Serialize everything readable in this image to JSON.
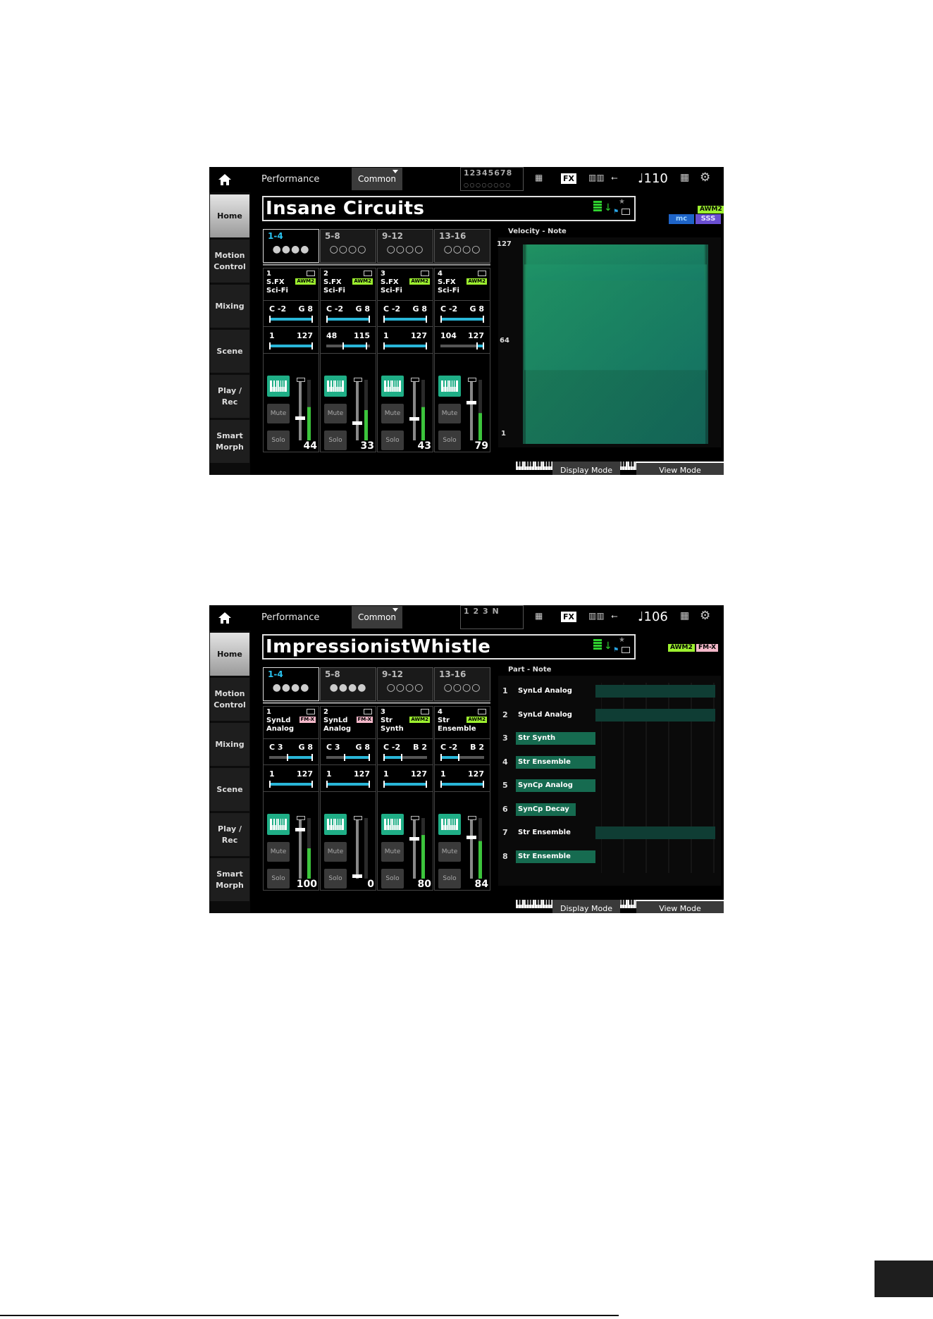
{
  "screens": [
    {
      "header": {
        "title": "Performance",
        "dropdown": "Common",
        "part_numbers": "12345678",
        "part_dots": "○○○○○○○○",
        "tempo": "♩110"
      },
      "sidebar": [
        "Home",
        "Motion Control",
        "Mixing",
        "Scene",
        "Play / Rec",
        "Smart Morph"
      ],
      "performance_name": "Insane Circuits",
      "engine_badges": [
        "AWM2"
      ],
      "group_tabs": [
        {
          "label": "1-4",
          "dots": "●●●●"
        },
        {
          "label": "5-8",
          "dots": "○○○○"
        },
        {
          "label": "9-12",
          "dots": "○○○○"
        },
        {
          "label": "13-16",
          "dots": "○○○○"
        }
      ],
      "parts": [
        {
          "num": "1",
          "cat": "S.FX",
          "sub": "Sci-Fi",
          "badge": "AWM2",
          "note_lo": "C -2",
          "note_hi": "G 8",
          "vel_lo": "1",
          "vel_hi": "127",
          "volume": "44",
          "note_range": [
            0,
            1
          ],
          "vel_range": [
            0,
            1
          ],
          "fader": 0.35,
          "meter": 0.55
        },
        {
          "num": "2",
          "cat": "S.FX",
          "sub": "Sci-Fi",
          "badge": "AWM2",
          "note_lo": "C -2",
          "note_hi": "G 8",
          "vel_lo": "48",
          "vel_hi": "115",
          "volume": "33",
          "note_range": [
            0,
            1
          ],
          "vel_range": [
            0.37,
            0.9
          ],
          "fader": 0.26,
          "meter": 0.5
        },
        {
          "num": "3",
          "cat": "S.FX",
          "sub": "Sci-Fi",
          "badge": "AWM2",
          "note_lo": "C -2",
          "note_hi": "G 8",
          "vel_lo": "1",
          "vel_hi": "127",
          "volume": "43",
          "note_range": [
            0,
            1
          ],
          "vel_range": [
            0,
            1
          ],
          "fader": 0.34,
          "meter": 0.55
        },
        {
          "num": "4",
          "cat": "S.FX",
          "sub": "Sci-Fi",
          "badge": "AWM2",
          "note_lo": "C -2",
          "note_hi": "G 8",
          "vel_lo": "104",
          "vel_hi": "127",
          "volume": "79",
          "note_range": [
            0,
            1
          ],
          "vel_range": [
            0.82,
            1
          ],
          "fader": 0.62,
          "meter": 0.45
        }
      ],
      "graph": {
        "title": "Velocity - Note",
        "y_top": "127",
        "y_mid": "64",
        "y_bot": "1"
      },
      "buttons": {
        "display": "Display Mode",
        "view": "View Mode"
      },
      "controls": {
        "mute": "Mute",
        "solo": "Solo"
      }
    },
    {
      "header": {
        "title": "Performance",
        "dropdown": "Common",
        "part_numbers": "1 2 3 N",
        "tempo": "♩106"
      },
      "sidebar": [
        "Home",
        "Motion Control",
        "Mixing",
        "Scene",
        "Play / Rec",
        "Smart Morph"
      ],
      "performance_name": "ImpressionistWhistle",
      "engine_badges": [
        "AWM2",
        "FM-X"
      ],
      "group_tabs": [
        {
          "label": "1-4",
          "dots": "●●●●"
        },
        {
          "label": "5-8",
          "dots": "●●●●"
        },
        {
          "label": "9-12",
          "dots": "○○○○"
        },
        {
          "label": "13-16",
          "dots": "○○○○"
        }
      ],
      "parts": [
        {
          "num": "1",
          "cat": "SynLd",
          "sub": "Analog",
          "badge": "FM-X",
          "note_lo": "C 3",
          "note_hi": "G 8",
          "vel_lo": "1",
          "vel_hi": "127",
          "volume": "100",
          "note_range": [
            0.4,
            1
          ],
          "vel_range": [
            0,
            1
          ],
          "fader": 0.82,
          "meter": 0.5
        },
        {
          "num": "2",
          "cat": "SynLd",
          "sub": "Analog",
          "badge": "FM-X",
          "note_lo": "C 3",
          "note_hi": "G 8",
          "vel_lo": "1",
          "vel_hi": "127",
          "volume": "0",
          "note_range": [
            0.4,
            1
          ],
          "vel_range": [
            0,
            1
          ],
          "fader": 0.0,
          "meter": 0.0
        },
        {
          "num": "3",
          "cat": "Str",
          "sub": "Synth",
          "badge": "AWM2",
          "note_lo": "C -2",
          "note_hi": "B 2",
          "vel_lo": "1",
          "vel_hi": "127",
          "volume": "80",
          "note_range": [
            0,
            0.4
          ],
          "vel_range": [
            0,
            1
          ],
          "fader": 0.66,
          "meter": 0.72
        },
        {
          "num": "4",
          "cat": "Str",
          "sub": "Ensemble",
          "badge": "AWM2",
          "note_lo": "C -2",
          "note_hi": "B 2",
          "vel_lo": "1",
          "vel_hi": "127",
          "volume": "84",
          "note_range": [
            0,
            0.4
          ],
          "vel_range": [
            0,
            1
          ],
          "fader": 0.69,
          "meter": 0.62
        }
      ],
      "graph": {
        "title": "Part - Note"
      },
      "part_note": [
        {
          "num": "1",
          "name": "SynLd Analog",
          "range": [
            0.4,
            1
          ]
        },
        {
          "num": "2",
          "name": "SynLd Analog",
          "range": [
            0.4,
            1
          ]
        },
        {
          "num": "3",
          "name": "Str Synth",
          "range": [
            0,
            0.4
          ]
        },
        {
          "num": "4",
          "name": "Str Ensemble",
          "range": [
            0,
            0.4
          ]
        },
        {
          "num": "5",
          "name": "SynCp Analog",
          "range": [
            0,
            0.4
          ]
        },
        {
          "num": "6",
          "name": "SynCp Decay",
          "range": [
            0,
            0.3
          ]
        },
        {
          "num": "7",
          "name": "Str Ensemble",
          "range": [
            0.4,
            1
          ]
        },
        {
          "num": "8",
          "name": "Str Ensemble",
          "range": [
            0,
            0.4
          ]
        }
      ],
      "buttons": {
        "display": "Display Mode",
        "view": "View Mode"
      },
      "controls": {
        "mute": "Mute",
        "solo": "Solo"
      }
    }
  ],
  "colors": {
    "accent_teal": "#1fae86",
    "awm2_badge": "#9df02f",
    "fmx_badge": "#f3b8c9",
    "tab_blue": "#29c2ef"
  }
}
